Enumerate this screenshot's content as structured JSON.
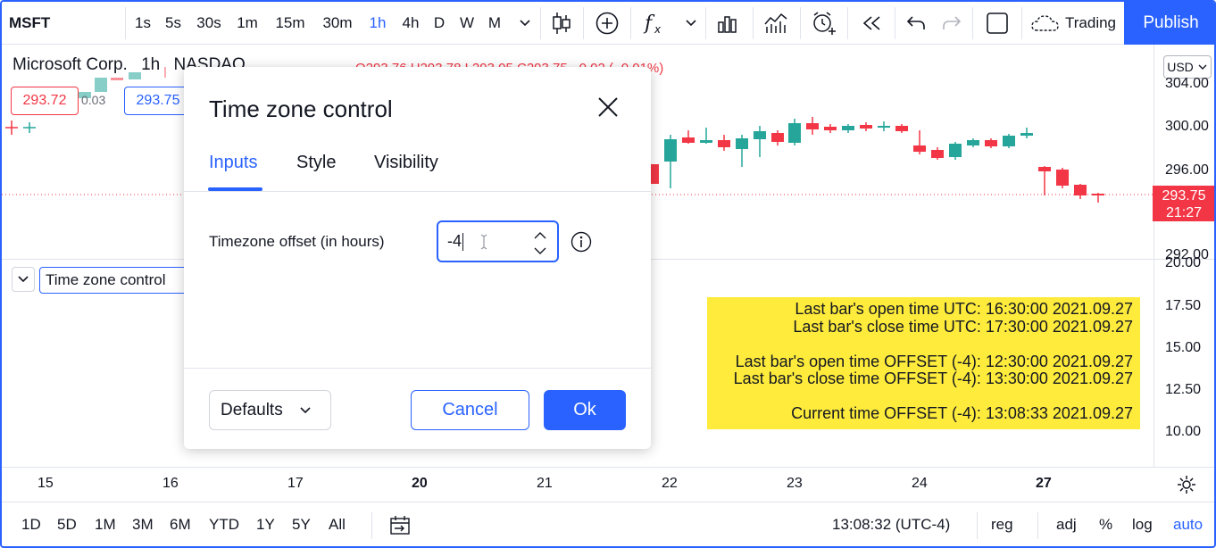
{
  "toolbar": {
    "symbol": "MSFT",
    "intervals": [
      "1s",
      "5s",
      "30s",
      "1m",
      "15m",
      "30m",
      "1h",
      "4h",
      "D",
      "W",
      "M"
    ],
    "active_interval": "1h",
    "trading_label": "Trading",
    "publish_label": "Publish"
  },
  "legend": {
    "name": "Microsoft Corp.",
    "interval": "1h",
    "exchange": "NASDAQ",
    "ohlc": "O293.76 H293.78 L293.05 C293.75 −0.02 (−0.01%)",
    "bid": "293.72",
    "spread": "0.03",
    "ask": "293.75"
  },
  "price_axis": {
    "currency": "USD",
    "ticks": [
      "304.00",
      "300.00",
      "296.00",
      "292.00"
    ],
    "last_price": "293.75",
    "countdown": "21:27"
  },
  "indicator": {
    "title": "Time zone control",
    "axis_ticks": [
      "20.00",
      "17.50",
      "15.00",
      "12.50",
      "10.00"
    ],
    "table": {
      "rows": [
        "Last bar's open time UTC: 16:30:00 2021.09.27",
        "Last bar's close time UTC: 17:30:00 2021.09.27",
        "",
        "Last bar's open time OFFSET (-4): 12:30:00 2021.09.27",
        "Last bar's close time OFFSET (-4): 13:30:00 2021.09.27",
        "",
        "Current time OFFSET (-4): 13:08:33 2021.09.27"
      ],
      "background": "#ffeb3b"
    }
  },
  "time_axis": {
    "labels": [
      "15",
      "16",
      "17",
      "20",
      "21",
      "22",
      "23",
      "24",
      "27"
    ]
  },
  "bottom_bar": {
    "ranges": [
      "1D",
      "5D",
      "1M",
      "3M",
      "6M",
      "YTD",
      "1Y",
      "5Y",
      "All"
    ],
    "clock": "13:08:32 (UTC-4)",
    "session": "reg",
    "adj": "adj",
    "percent": "%",
    "log": "log",
    "auto": "auto"
  },
  "dialog": {
    "title": "Time zone control",
    "tabs": [
      "Inputs",
      "Style",
      "Visibility"
    ],
    "active_tab": "Inputs",
    "field_label": "Timezone offset (in hours)",
    "field_value": "-4",
    "defaults_label": "Defaults",
    "cancel_label": "Cancel",
    "ok_label": "Ok"
  },
  "colors": {
    "accent": "#2962ff",
    "up": "#26a69a",
    "down": "#f23645"
  }
}
